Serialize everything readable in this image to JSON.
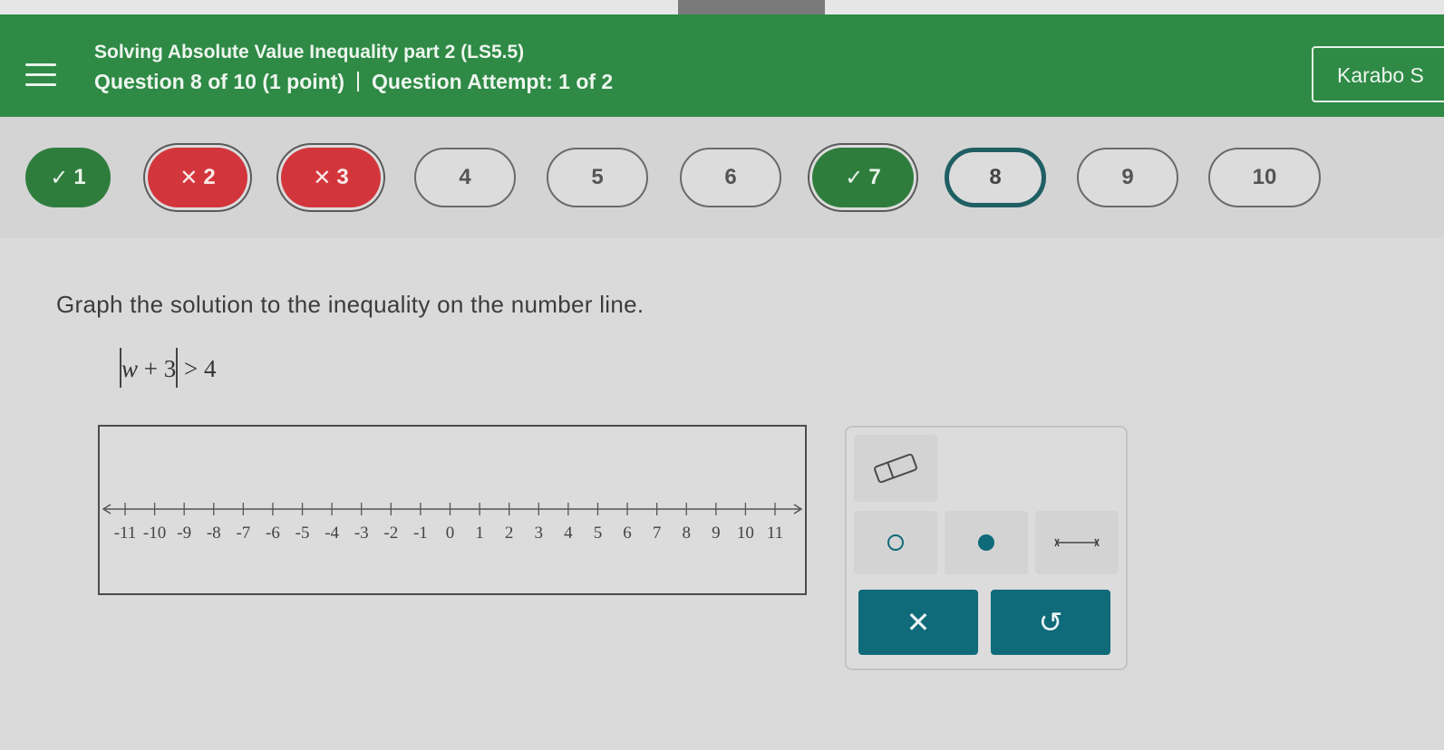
{
  "header": {
    "title": "Solving Absolute Value Inequality part 2 (LS5.5)",
    "question_progress": "Question 8 of 10 (1 point)",
    "attempt": "Question Attempt: 1 of 2",
    "user_name": "Karabo S",
    "menu_icon": "hamburger-menu-icon"
  },
  "colors": {
    "header_bg": "#2e8a45",
    "correct": "#2f7d3d",
    "incorrect": "#d2363c",
    "current_ring": "#1f5f64",
    "action_button": "#0f6a7a",
    "accent_dot": "#0f6a7a"
  },
  "questions": [
    {
      "label": "1",
      "status": "correct",
      "mark": "✓"
    },
    {
      "label": "2",
      "status": "incorrect",
      "mark": "✕"
    },
    {
      "label": "3",
      "status": "incorrect",
      "mark": "✕"
    },
    {
      "label": "4",
      "status": "unanswered",
      "mark": ""
    },
    {
      "label": "5",
      "status": "unanswered",
      "mark": ""
    },
    {
      "label": "6",
      "status": "unanswered",
      "mark": ""
    },
    {
      "label": "7",
      "status": "correct",
      "mark": "✓"
    },
    {
      "label": "8",
      "status": "current",
      "mark": ""
    },
    {
      "label": "9",
      "status": "unanswered",
      "mark": ""
    },
    {
      "label": "10",
      "status": "unanswered",
      "mark": ""
    }
  ],
  "problem": {
    "prompt": "Graph the solution to the inequality on the number line.",
    "expression": {
      "variable": "w",
      "inner_rest": " + 3",
      "relation": " > 4"
    }
  },
  "number_line": {
    "min": -11,
    "max": 11,
    "labels": [
      "-11",
      "-10",
      "-9",
      "-8",
      "-7",
      "-6",
      "-5",
      "-4",
      "-3",
      "-2",
      "-1",
      "0",
      "1",
      "2",
      "3",
      "4",
      "5",
      "6",
      "7",
      "8",
      "9",
      "10",
      "11"
    ]
  },
  "tools": {
    "eraser_icon": "eraser-icon",
    "open_point_icon": "open-circle-icon",
    "closed_point_icon": "filled-circle-icon",
    "ray_icon": "ray-segment-icon"
  },
  "actions": {
    "clear_glyph": "✕",
    "undo_glyph": "↺"
  }
}
